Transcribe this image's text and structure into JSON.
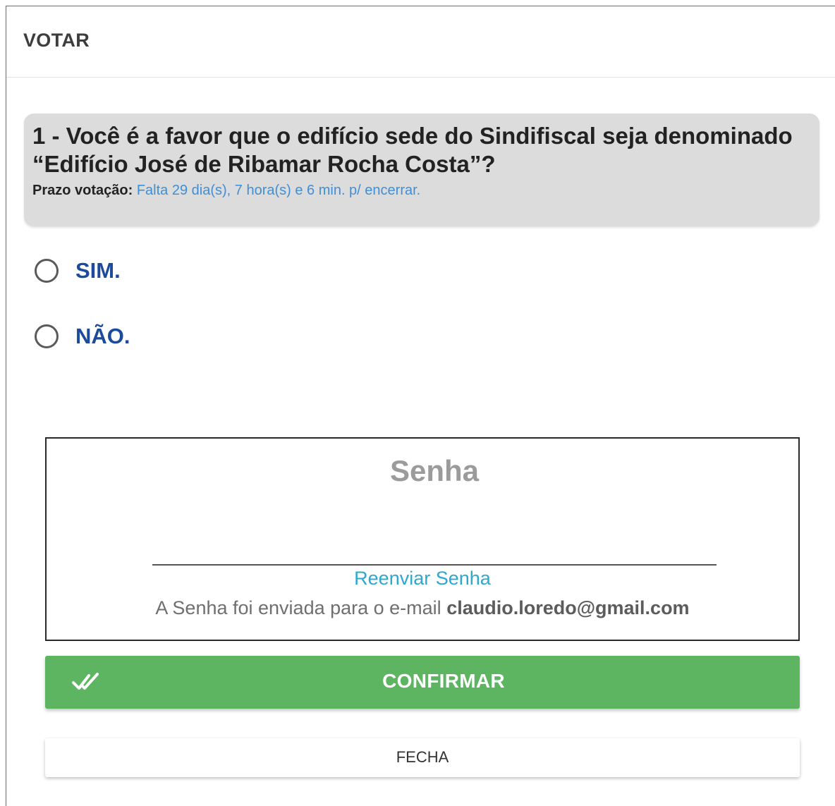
{
  "header": {
    "title": "VOTAR"
  },
  "question": {
    "text": "1 - Você é a favor que o edifício sede do Sindifiscal seja denominado “Edifício José de Ribamar Rocha Costa”?",
    "deadline_label": "Prazo votação:",
    "deadline_value": "Falta 29 dia(s), 7 hora(s) e 6 min. p/ encerrar."
  },
  "options": [
    {
      "label": "SIM.",
      "selected": false
    },
    {
      "label": "NÃO.",
      "selected": false
    }
  ],
  "password": {
    "placeholder": "Senha",
    "value": "",
    "resend_label": "Reenviar Senha",
    "sent_text": "A Senha foi enviada para o e-mail",
    "email": "claudio.loredo@gmail.com"
  },
  "actions": {
    "confirm_label": "CONFIRMAR",
    "confirm_icon": "double-check-icon",
    "close_label": "FECHA"
  },
  "colors": {
    "confirm_bg": "#5db561",
    "option_label": "#1d4b9c",
    "link": "#2ea7d1",
    "deadline_value": "#3f8fd8"
  }
}
